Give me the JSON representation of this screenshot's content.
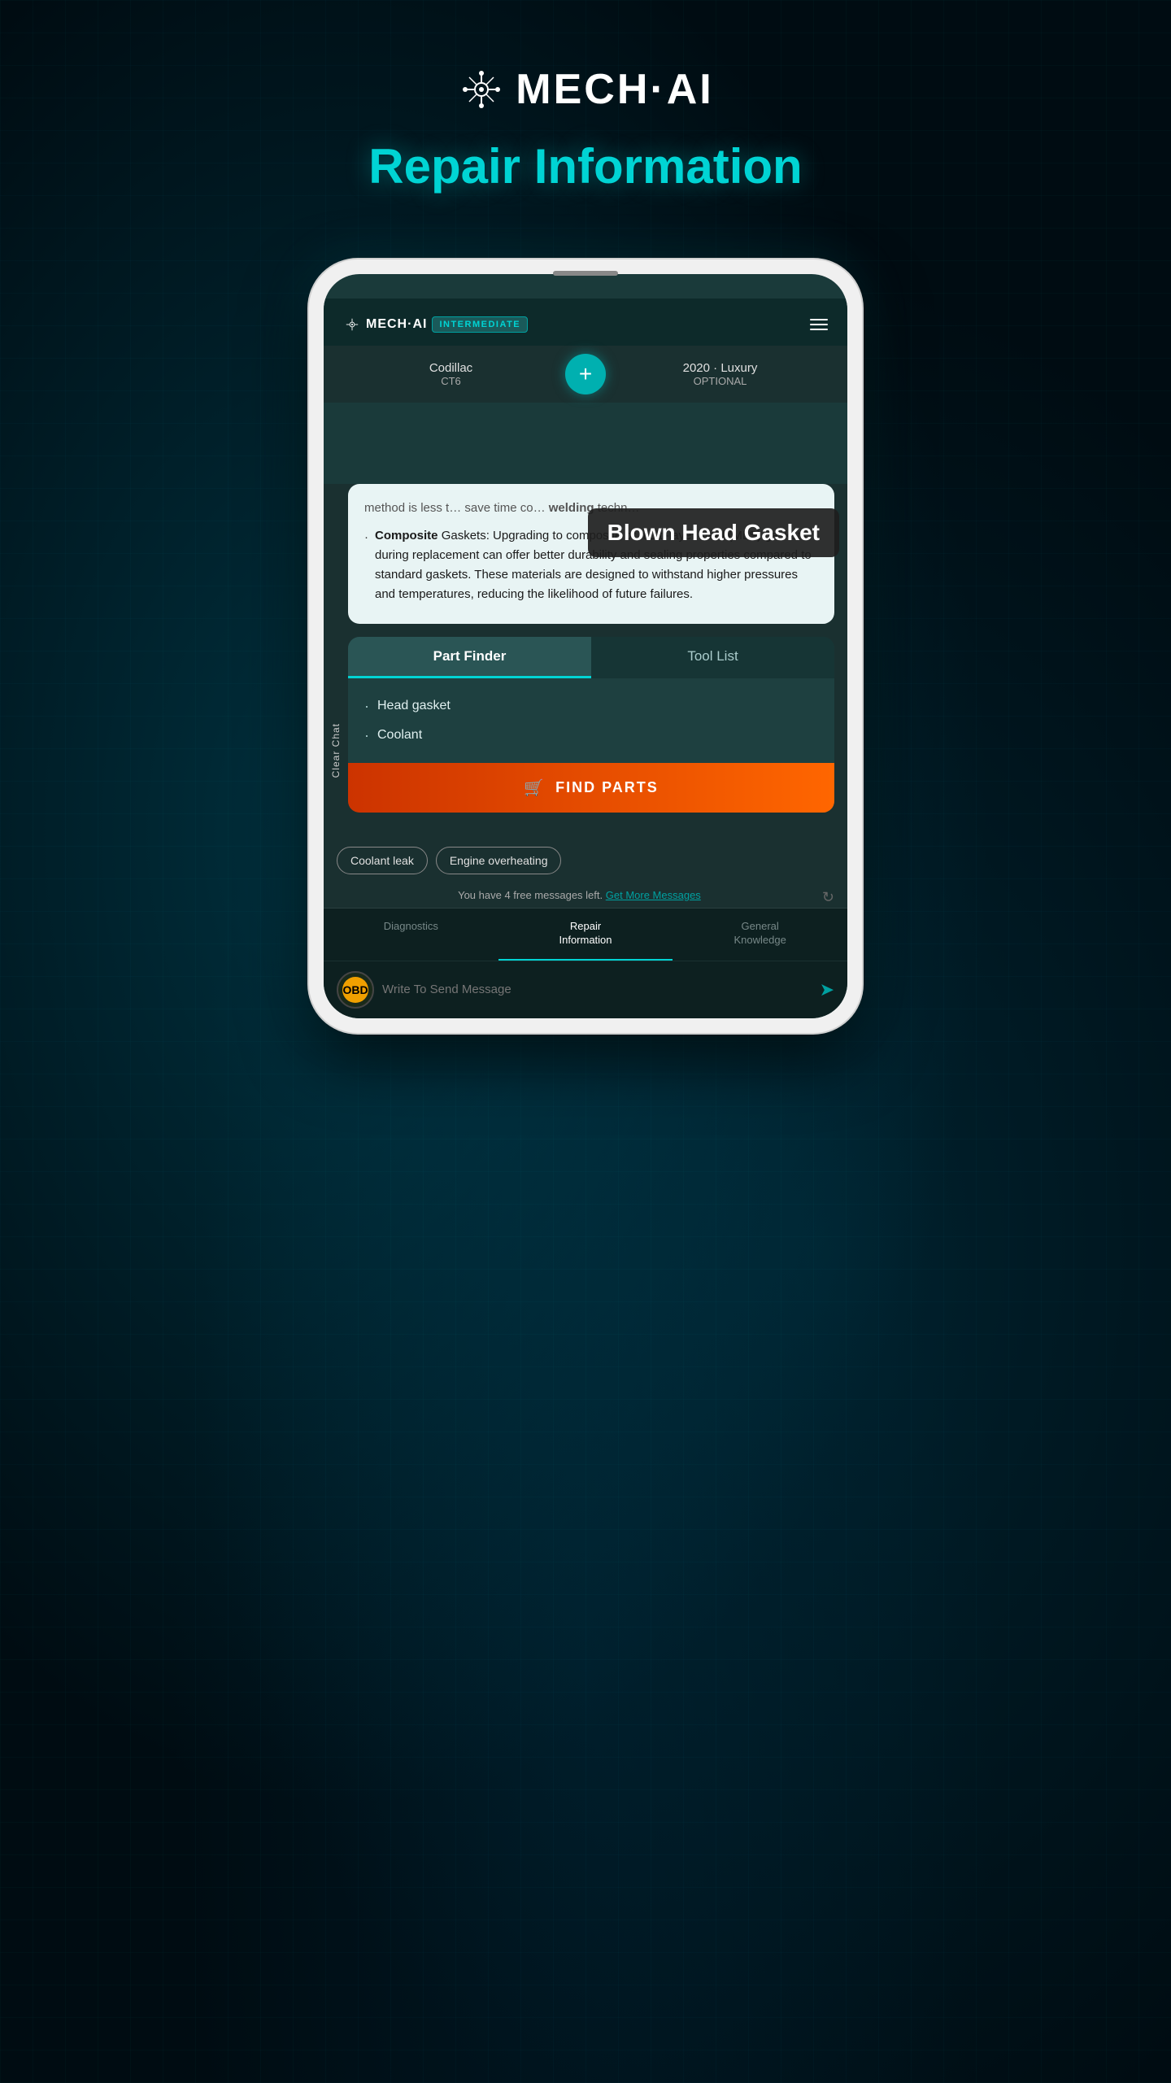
{
  "branding": {
    "logo_text": "MECH·AI",
    "dot": "·",
    "page_title": "Repair Information"
  },
  "app": {
    "header": {
      "logo": "⬡ MECH·AI",
      "badge": "INTERMEDIATE",
      "menu_icon": "hamburger"
    },
    "vehicle": {
      "left_name": "Codillac",
      "left_model": "CT6",
      "right_year": "2020 · Luxury",
      "right_trim": "OPTIONAL",
      "add_button": "+"
    },
    "clear_chat": "Clear Chat",
    "tooltip": {
      "text": "Blown Head Gasket"
    },
    "message_content": {
      "partial": "method is less t... save time co... welding techn...",
      "bullet_label": "Composite",
      "bullet_after": "Gaskets:",
      "bullet_text": "Upgrading to composite or multi-layer steel (MLS) gaskets during replacement can offer better durability and sealing properties compared to standard gaskets. These materials are designed to withstand higher pressures and temperatures, reducing the likelihood of future failures."
    },
    "part_finder": {
      "tab1": "Part Finder",
      "tab2": "Tool List",
      "parts": [
        "Head gasket",
        "Coolant"
      ],
      "find_parts_btn": "FIND PARTS"
    },
    "suggestions": {
      "chip1": "Coolant leak",
      "chip2": "Engine overheating"
    },
    "free_messages": {
      "text": "You have 4 free messages left.",
      "link": "Get More Messages"
    },
    "nav": {
      "item1": "Diagnostics",
      "item2": "Repair\nInformation",
      "item3": "General\nKnowledge"
    },
    "input": {
      "placeholder": "Write To Send Message"
    }
  }
}
